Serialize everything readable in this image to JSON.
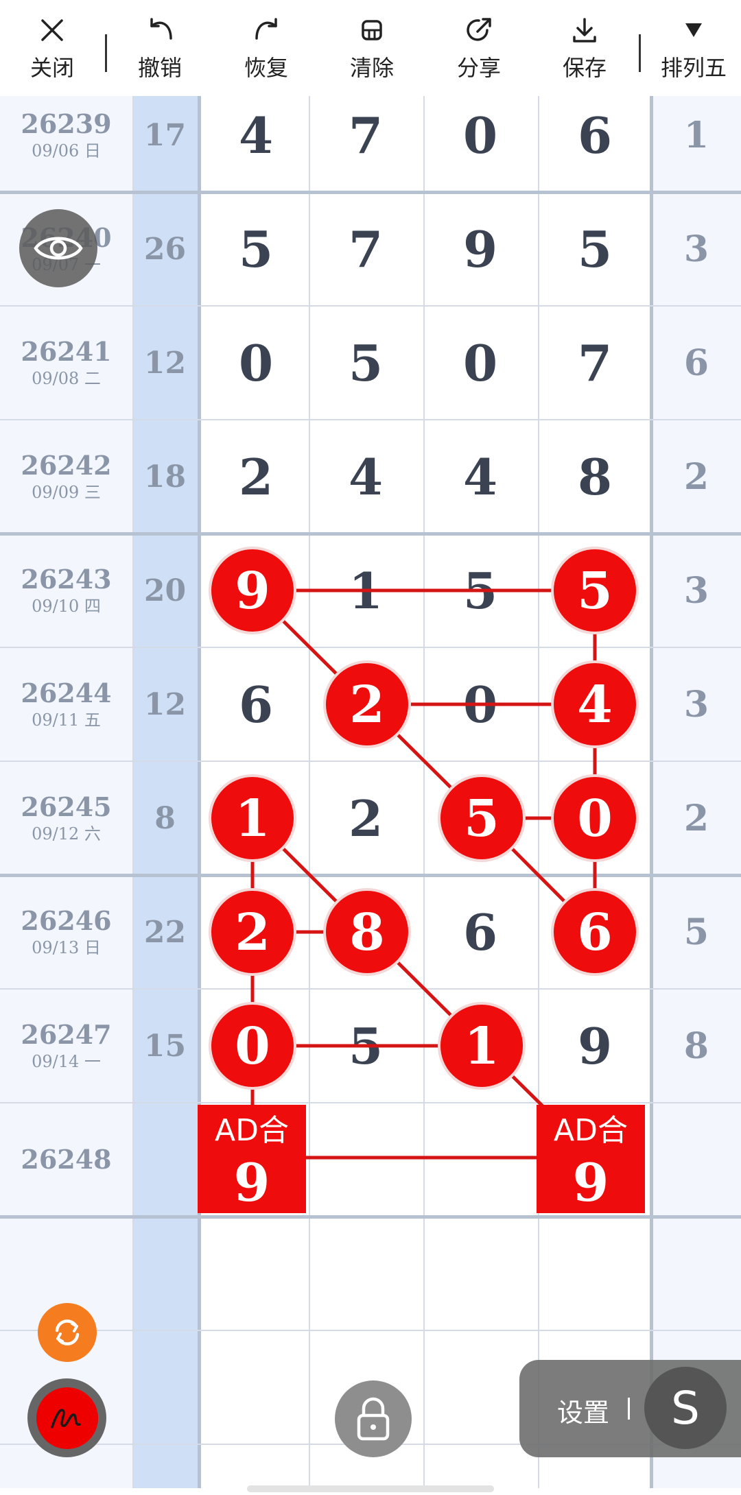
{
  "toolbar": {
    "items": [
      {
        "label": "关闭",
        "icon": "close-icon"
      },
      {
        "label": "撤销",
        "icon": "undo-icon"
      },
      {
        "label": "恢复",
        "icon": "redo-icon"
      },
      {
        "label": "清除",
        "icon": "eraser-icon"
      },
      {
        "label": "分享",
        "icon": "share-icon"
      },
      {
        "label": "保存",
        "icon": "download-icon"
      },
      {
        "label": "排列五",
        "icon": "triangle-down-icon"
      }
    ]
  },
  "rows": [
    {
      "issue": "26239",
      "date": "09/06 日",
      "sum": "17",
      "digits": [
        "4",
        "7",
        "0",
        "6"
      ],
      "last": "1"
    },
    {
      "issue": "26240",
      "date": "09/07 一",
      "sum": "26",
      "digits": [
        "5",
        "7",
        "9",
        "5"
      ],
      "last": "3"
    },
    {
      "issue": "26241",
      "date": "09/08 二",
      "sum": "12",
      "digits": [
        "0",
        "5",
        "0",
        "7"
      ],
      "last": "6"
    },
    {
      "issue": "26242",
      "date": "09/09 三",
      "sum": "18",
      "digits": [
        "2",
        "4",
        "4",
        "8"
      ],
      "last": "2"
    },
    {
      "issue": "26243",
      "date": "09/10 四",
      "sum": "20",
      "digits": [
        "9",
        "1",
        "5",
        "5"
      ],
      "last": "3"
    },
    {
      "issue": "26244",
      "date": "09/11 五",
      "sum": "12",
      "digits": [
        "6",
        "2",
        "0",
        "4"
      ],
      "last": "3"
    },
    {
      "issue": "26245",
      "date": "09/12 六",
      "sum": "8",
      "digits": [
        "1",
        "2",
        "5",
        "0"
      ],
      "last": "2"
    },
    {
      "issue": "26246",
      "date": "09/13 日",
      "sum": "22",
      "digits": [
        "2",
        "8",
        "6",
        "6"
      ],
      "last": "5"
    },
    {
      "issue": "26247",
      "date": "09/14 一",
      "sum": "15",
      "digits": [
        "0",
        "5",
        "1",
        "9"
      ],
      "last": "8"
    }
  ],
  "next_issue": "26248",
  "circled": [
    {
      "row": 4,
      "col": 0
    },
    {
      "row": 4,
      "col": 3
    },
    {
      "row": 5,
      "col": 1
    },
    {
      "row": 5,
      "col": 3
    },
    {
      "row": 6,
      "col": 0
    },
    {
      "row": 6,
      "col": 2
    },
    {
      "row": 6,
      "col": 3
    },
    {
      "row": 7,
      "col": 0
    },
    {
      "row": 7,
      "col": 1
    },
    {
      "row": 7,
      "col": 3
    },
    {
      "row": 8,
      "col": 0
    },
    {
      "row": 8,
      "col": 2
    }
  ],
  "lines": [
    [
      {
        "row": 4,
        "col": 0
      },
      {
        "row": 4,
        "col": 3
      }
    ],
    [
      {
        "row": 4,
        "col": 0
      },
      {
        "row": 5,
        "col": 1
      }
    ],
    [
      {
        "row": 4,
        "col": 3
      },
      {
        "row": 5,
        "col": 3
      }
    ],
    [
      {
        "row": 5,
        "col": 1
      },
      {
        "row": 5,
        "col": 3
      }
    ],
    [
      {
        "row": 5,
        "col": 1
      },
      {
        "row": 6,
        "col": 2
      }
    ],
    [
      {
        "row": 5,
        "col": 3
      },
      {
        "row": 6,
        "col": 3
      }
    ],
    [
      {
        "row": 6,
        "col": 2
      },
      {
        "row": 6,
        "col": 3
      }
    ],
    [
      {
        "row": 6,
        "col": 2
      },
      {
        "row": 7,
        "col": 3
      }
    ],
    [
      {
        "row": 6,
        "col": 3
      },
      {
        "row": 7,
        "col": 3
      }
    ],
    [
      {
        "row": 6,
        "col": 0
      },
      {
        "row": 7,
        "col": 0
      }
    ],
    [
      {
        "row": 6,
        "col": 0
      },
      {
        "row": 7,
        "col": 1
      }
    ],
    [
      {
        "row": 7,
        "col": 0
      },
      {
        "row": 7,
        "col": 1
      }
    ],
    [
      {
        "row": 7,
        "col": 0
      },
      {
        "row": 8,
        "col": 0
      }
    ],
    [
      {
        "row": 7,
        "col": 1
      },
      {
        "row": 8,
        "col": 2
      }
    ],
    [
      {
        "row": 8,
        "col": 0
      },
      {
        "row": 8,
        "col": 2
      }
    ],
    [
      {
        "row": 8,
        "col": 0
      },
      {
        "row": 9,
        "col": 0
      }
    ],
    [
      {
        "row": 8,
        "col": 2
      },
      {
        "row": 9,
        "col": 3
      }
    ],
    [
      {
        "row": 9,
        "col": 0
      },
      {
        "row": 9,
        "col": 3
      }
    ]
  ],
  "ad_boxes": [
    {
      "col": 0,
      "label": "AD合",
      "value": "9"
    },
    {
      "col": 3,
      "label": "AD合",
      "value": "9"
    }
  ],
  "settings": {
    "label": "设置",
    "s_letter": "S"
  },
  "colors": {
    "circle": "#ee0c0c",
    "line": "#d51414",
    "sum_column": "#cfdff5",
    "side_columns": "#f3f7fd",
    "refresh": "#f57c1f"
  }
}
